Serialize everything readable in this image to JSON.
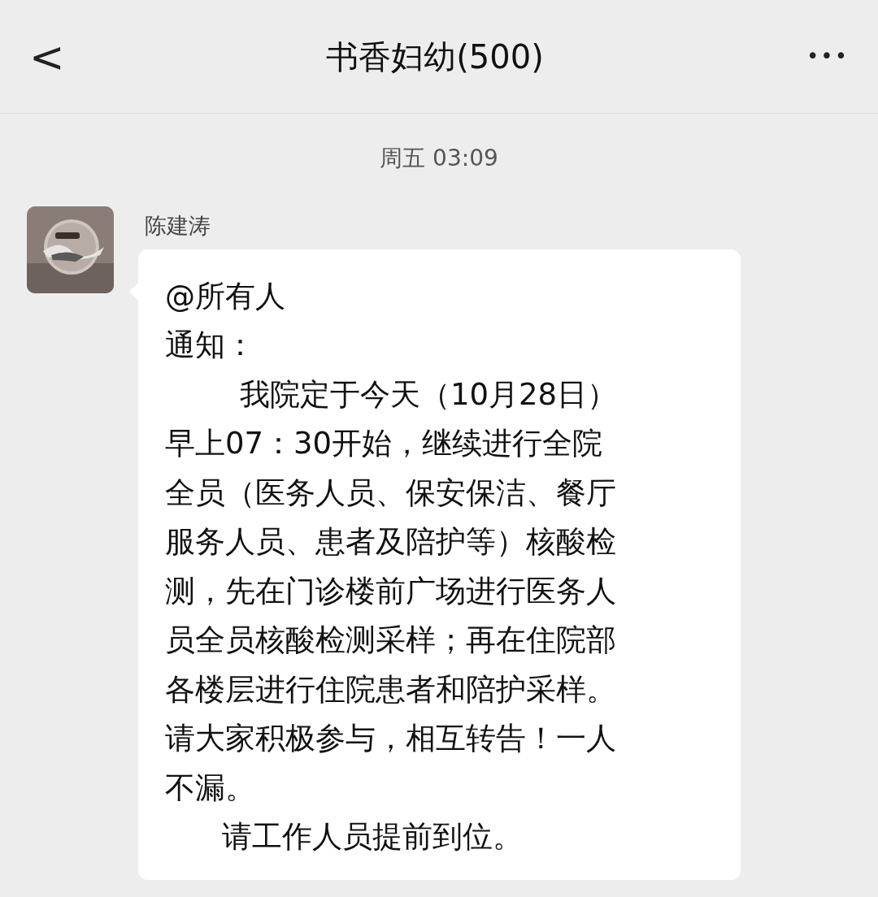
{
  "header": {
    "back": "<",
    "title": "书香妇幼(500)",
    "more": "•••"
  },
  "timestamp": "周五 03:09",
  "message": {
    "sender": "陈建涛",
    "lines": [
      {
        "text": "@所有人"
      },
      {
        "text": "通知："
      },
      {
        "text": "我院定于今天（10月28日）",
        "kind": "opening"
      },
      {
        "text": "早上07：30开始，继续进行全院"
      },
      {
        "text": "全员（医务人员、保安保洁、餐厅"
      },
      {
        "text": "服务人员、患者及陪护等）核酸检"
      },
      {
        "text": "测，先在门诊楼前广场进行医务人"
      },
      {
        "text": "员全员核酸检测采样；再在住院部"
      },
      {
        "text": "各楼层进行住院患者和陪护采样。"
      },
      {
        "text": "请大家积极参与，相互转告！一人"
      },
      {
        "text": "不漏。"
      },
      {
        "text": "请工作人员提前到位。",
        "kind": "closing"
      }
    ]
  }
}
